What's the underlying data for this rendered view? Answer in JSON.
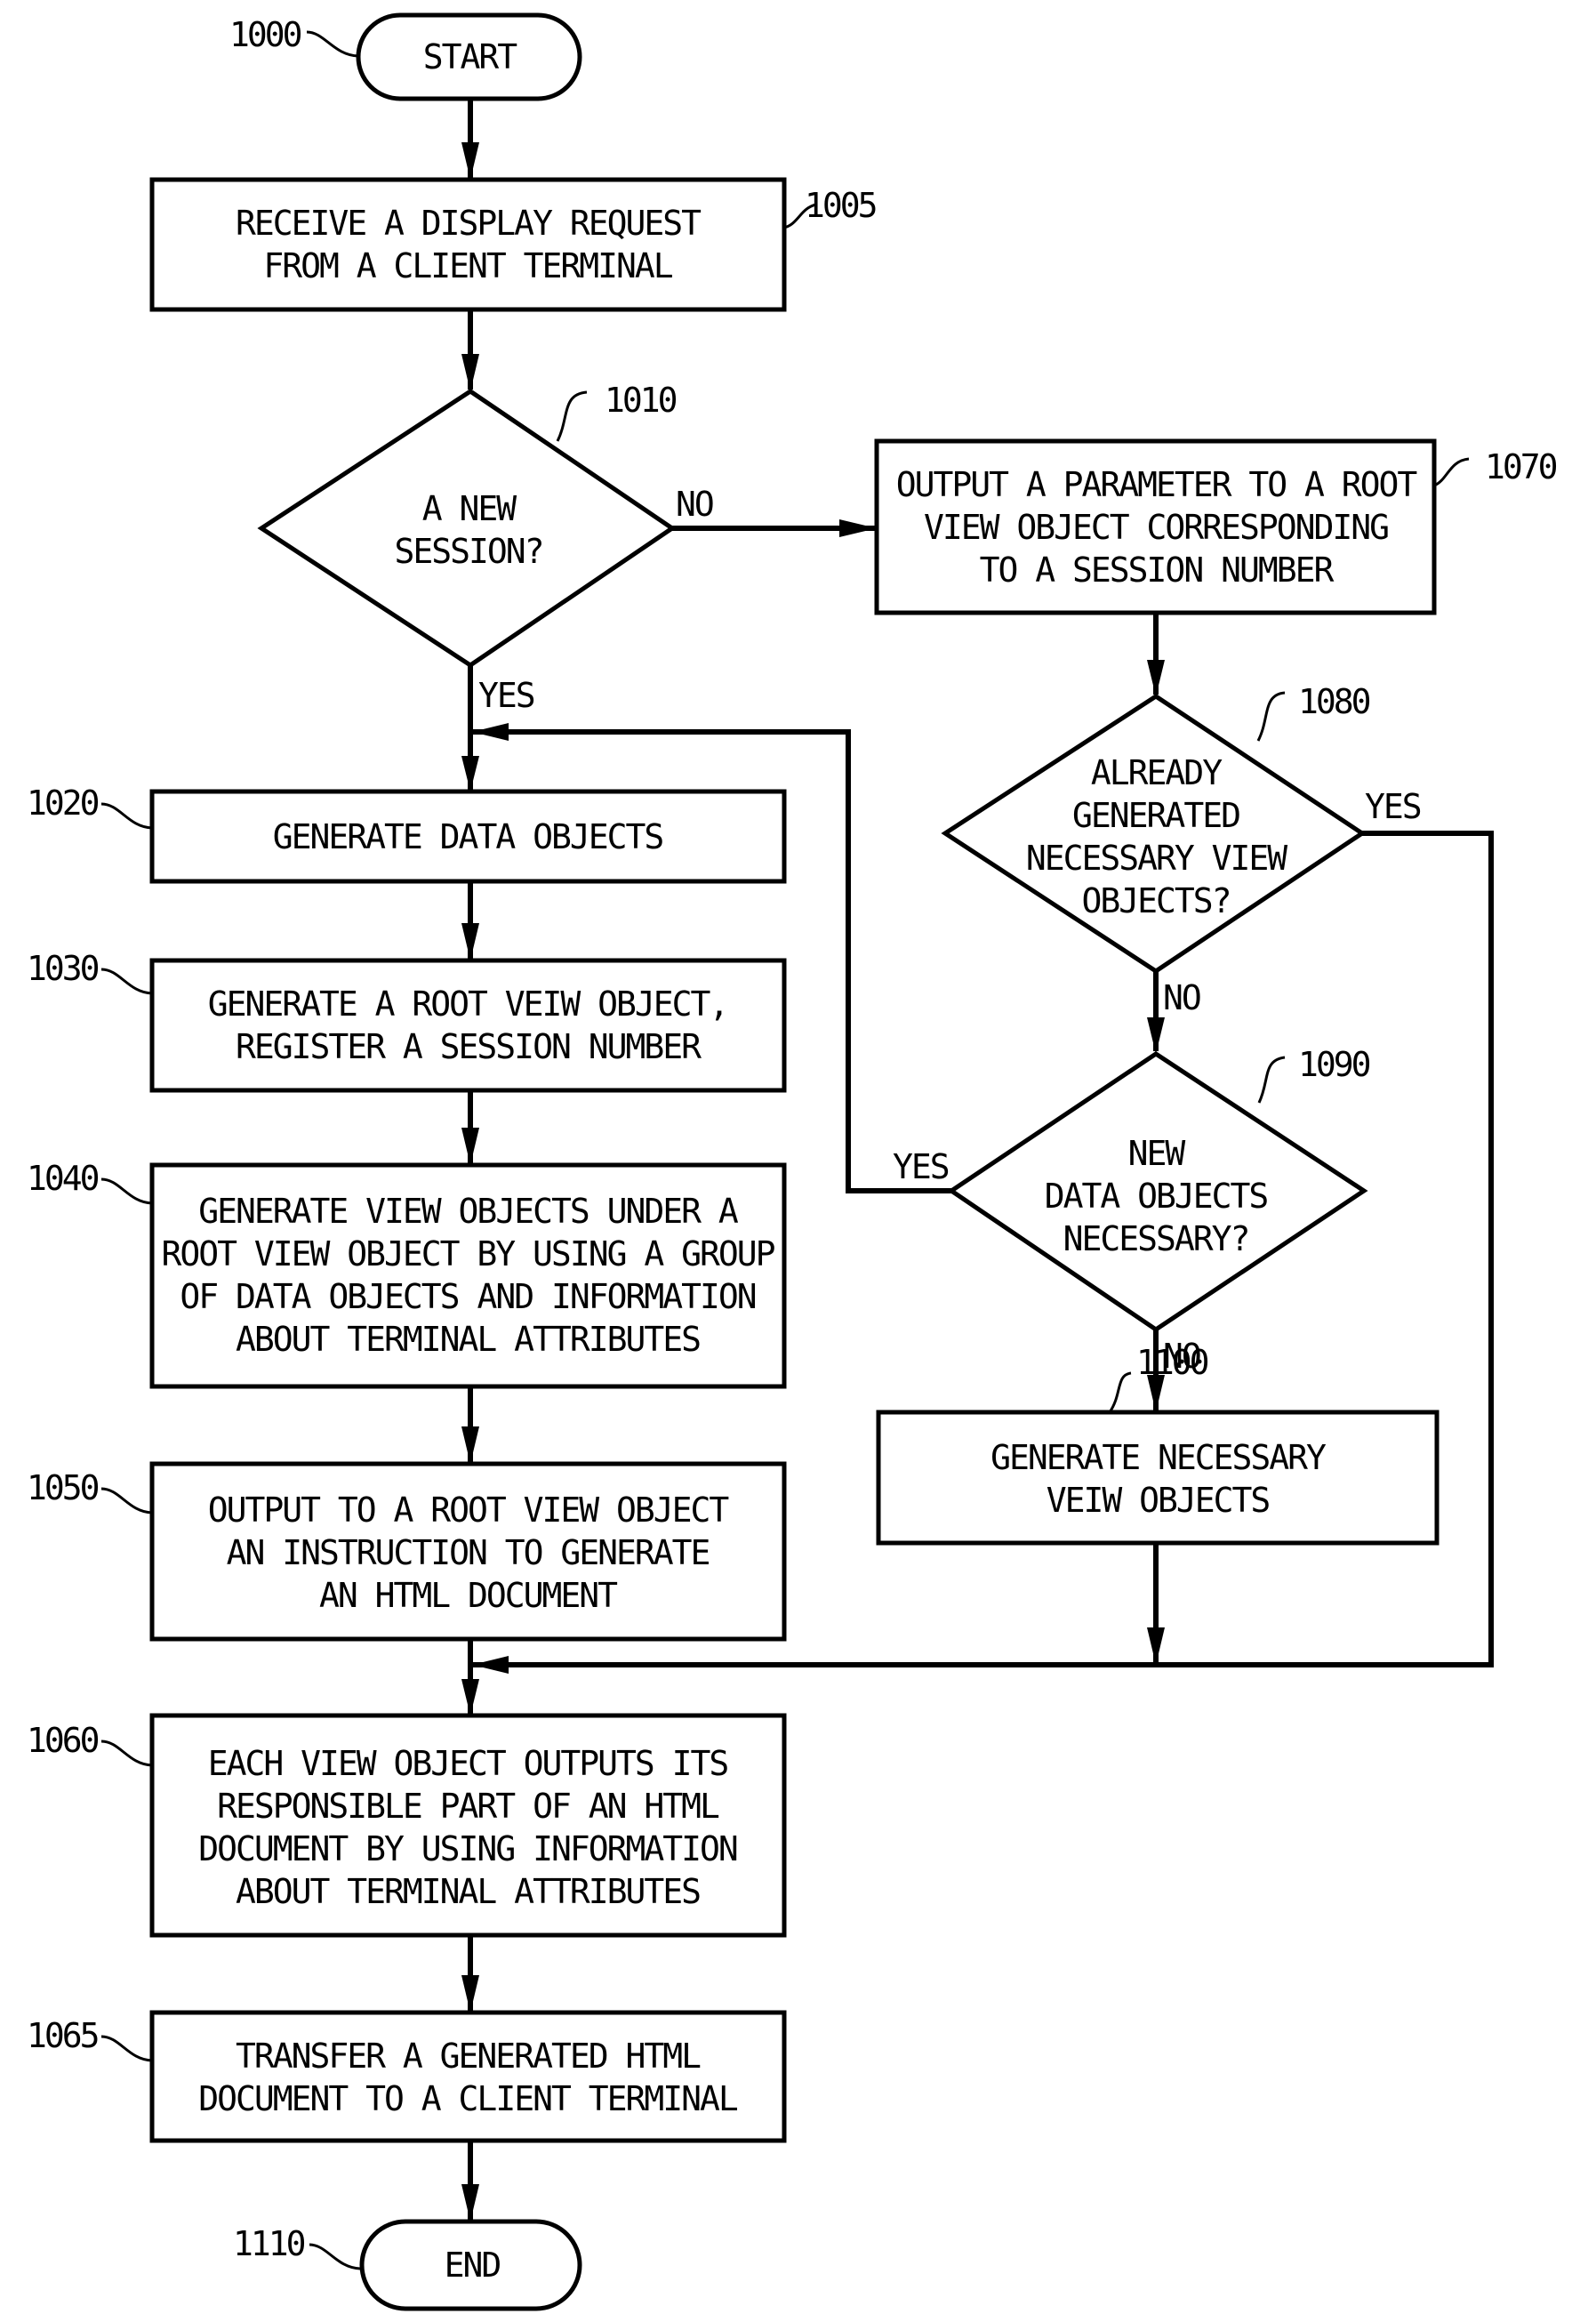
{
  "diagram": {
    "type": "flowchart",
    "nodes": {
      "n1000": {
        "ref": "1000",
        "shape": "terminal",
        "lines": [
          "START"
        ]
      },
      "n1005": {
        "ref": "1005",
        "shape": "process",
        "lines": [
          "RECEIVE A DISPLAY REQUEST",
          "FROM A CLIENT TERMINAL"
        ]
      },
      "n1010": {
        "ref": "1010",
        "shape": "decision",
        "lines": [
          "A NEW",
          "SESSION?"
        ]
      },
      "n1020": {
        "ref": "1020",
        "shape": "process",
        "lines": [
          "GENERATE DATA OBJECTS"
        ]
      },
      "n1030": {
        "ref": "1030",
        "shape": "process",
        "lines": [
          "GENERATE A ROOT VEIW OBJECT,",
          "REGISTER A SESSION NUMBER"
        ]
      },
      "n1040": {
        "ref": "1040",
        "shape": "process",
        "lines": [
          "GENERATE VIEW OBJECTS UNDER A",
          "ROOT VIEW OBJECT BY USING A GROUP",
          "OF DATA OBJECTS AND INFORMATION",
          "ABOUT TERMINAL ATTRIBUTES"
        ]
      },
      "n1050": {
        "ref": "1050",
        "shape": "process",
        "lines": [
          "OUTPUT TO A ROOT VIEW OBJECT",
          "AN INSTRUCTION TO GENERATE",
          "AN HTML DOCUMENT"
        ]
      },
      "n1060": {
        "ref": "1060",
        "shape": "process",
        "lines": [
          "EACH VIEW OBJECT OUTPUTS ITS",
          "RESPONSIBLE PART OF AN HTML",
          "DOCUMENT BY USING INFORMATION",
          "ABOUT TERMINAL ATTRIBUTES"
        ]
      },
      "n1065": {
        "ref": "1065",
        "shape": "process",
        "lines": [
          "TRANSFER A GENERATED HTML",
          "DOCUMENT TO A CLIENT TERMINAL"
        ]
      },
      "n1070": {
        "ref": "1070",
        "shape": "process",
        "lines": [
          "OUTPUT A PARAMETER TO A ROOT",
          "VIEW OBJECT CORRESPONDING",
          "TO A SESSION NUMBER"
        ]
      },
      "n1080": {
        "ref": "1080",
        "shape": "decision",
        "lines": [
          "ALREADY",
          "GENERATED",
          "NECESSARY VIEW",
          "OBJECTS?"
        ]
      },
      "n1090": {
        "ref": "1090",
        "shape": "decision",
        "lines": [
          "NEW",
          "DATA OBJECTS",
          "NECESSARY?"
        ]
      },
      "n1100": {
        "ref": "1100",
        "shape": "process",
        "lines": [
          "GENERATE NECESSARY",
          "VEIW OBJECTS"
        ]
      },
      "n1110": {
        "ref": "1110",
        "shape": "terminal",
        "lines": [
          "END"
        ]
      }
    },
    "edges": [
      {
        "from": "1000",
        "to": "1005",
        "label": ""
      },
      {
        "from": "1005",
        "to": "1010",
        "label": ""
      },
      {
        "from": "1010",
        "to": "1020",
        "label": "YES"
      },
      {
        "from": "1010",
        "to": "1070",
        "label": "NO"
      },
      {
        "from": "1020",
        "to": "1030",
        "label": ""
      },
      {
        "from": "1030",
        "to": "1040",
        "label": ""
      },
      {
        "from": "1040",
        "to": "1050",
        "label": ""
      },
      {
        "from": "1050",
        "to": "1060",
        "label": ""
      },
      {
        "from": "1060",
        "to": "1065",
        "label": ""
      },
      {
        "from": "1065",
        "to": "1110",
        "label": ""
      },
      {
        "from": "1070",
        "to": "1080",
        "label": ""
      },
      {
        "from": "1080",
        "to": "1060",
        "label": "YES"
      },
      {
        "from": "1080",
        "to": "1090",
        "label": "NO"
      },
      {
        "from": "1090",
        "to": "1020",
        "label": "YES"
      },
      {
        "from": "1090",
        "to": "1100",
        "label": "NO"
      },
      {
        "from": "1100",
        "to": "1060",
        "label": ""
      }
    ],
    "branch_labels": {
      "d1010_no": "NO",
      "d1010_yes": "YES",
      "d1080_yes": "YES",
      "d1080_no": "NO",
      "d1090_yes": "YES",
      "d1090_no": "NO"
    }
  }
}
